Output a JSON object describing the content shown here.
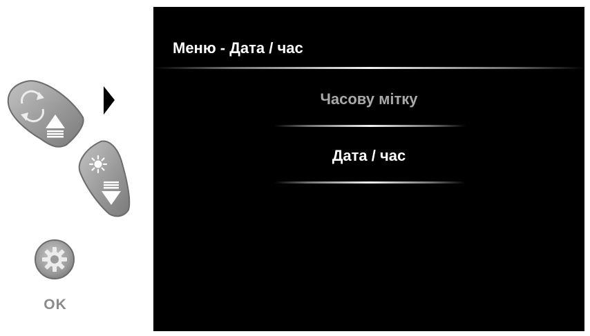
{
  "controls": {
    "rotate_button_icon": "rotate-arrows-icon",
    "up_arrow_icon": "triangle-up-lines-icon",
    "brightness_button_icon": "sun-icon",
    "down_arrow_icon": "triangle-down-lines-icon",
    "ok_button_icon": "gear-icon",
    "ok_label": "OK",
    "pointer_icon": "triangle-right-icon"
  },
  "screen": {
    "title": "Меню - Дата / час",
    "menu_items": [
      {
        "label": "Часову мітку",
        "state": "inactive"
      },
      {
        "label": "Дата / час",
        "state": "selected"
      }
    ]
  },
  "colors": {
    "screen_background": "#000000",
    "title_text": "#ffffff",
    "selected_text": "#ffffff",
    "inactive_text": "#a9a9a9",
    "button_fill": "#9a9a9a",
    "page_background": "#ffffff"
  }
}
